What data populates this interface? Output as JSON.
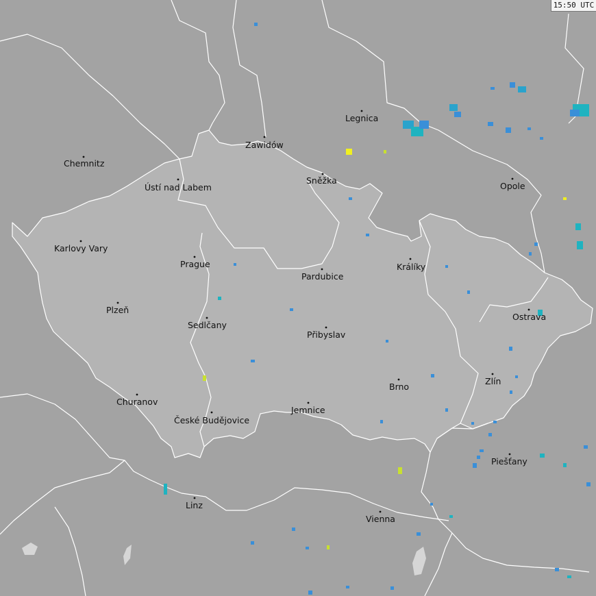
{
  "timestamp": "15:50 UTC",
  "cities": {
    "legnica": "Legnica",
    "chemnitz": "Chemnitz",
    "zawidow": "Zawidów",
    "usti": "Ústí nad Labem",
    "snezka": "Sněžka",
    "opole": "Opole",
    "karlovy_vary": "Karlovy Vary",
    "prague": "Prague",
    "pardubice": "Pardubice",
    "kraliky": "Králíky",
    "plzen": "Plzeň",
    "sedlcany": "Sedlčany",
    "pribyslav": "Přibyslav",
    "ostrava": "Ostrava",
    "zlin": "Zlín",
    "brno": "Brno",
    "churanov": "Churanov",
    "ceske_budejovice": "České Budějovice",
    "jemnice": "Jemnice",
    "piestany": "Piešťany",
    "linz": "Linz",
    "vienna": "Vienna"
  },
  "colors": {
    "background": "#a3a3a3",
    "czech_fill": "#b4b4b4",
    "border": "#ffffff",
    "water": "#d0d0d0",
    "rain_light": "#3a8fd8",
    "rain_moderate": "#1fb3c0",
    "rain_heavy": "#c8e030",
    "rain_intense": "#f0f020"
  }
}
